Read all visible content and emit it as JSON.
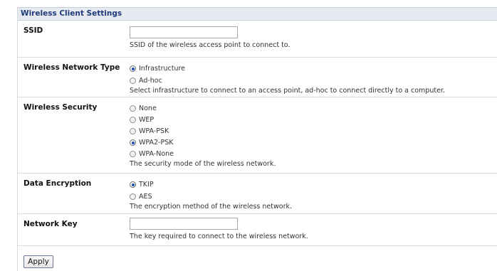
{
  "section_title": "Wireless Client Settings",
  "ssid": {
    "label": "SSID",
    "value": "",
    "help": "SSID of the wireless access point to connect to."
  },
  "network_type": {
    "label": "Wireless Network Type",
    "options": [
      "Infrastructure",
      "Ad-hoc"
    ],
    "selected": "Infrastructure",
    "help": "Select infrastructure to connect to an access point, ad-hoc to connect directly to a computer."
  },
  "security": {
    "label": "Wireless Security",
    "options": [
      "None",
      "WEP",
      "WPA-PSK",
      "WPA2-PSK",
      "WPA-None"
    ],
    "selected": "WPA2-PSK",
    "help": "The security mode of the wireless network."
  },
  "encryption": {
    "label": "Data Encryption",
    "options": [
      "TKIP",
      "AES"
    ],
    "selected": "TKIP",
    "help": "The encryption method of the wireless network."
  },
  "network_key": {
    "label": "Network Key",
    "value": "",
    "help": "The key required to connect to the wireless network."
  },
  "apply_label": "Apply"
}
